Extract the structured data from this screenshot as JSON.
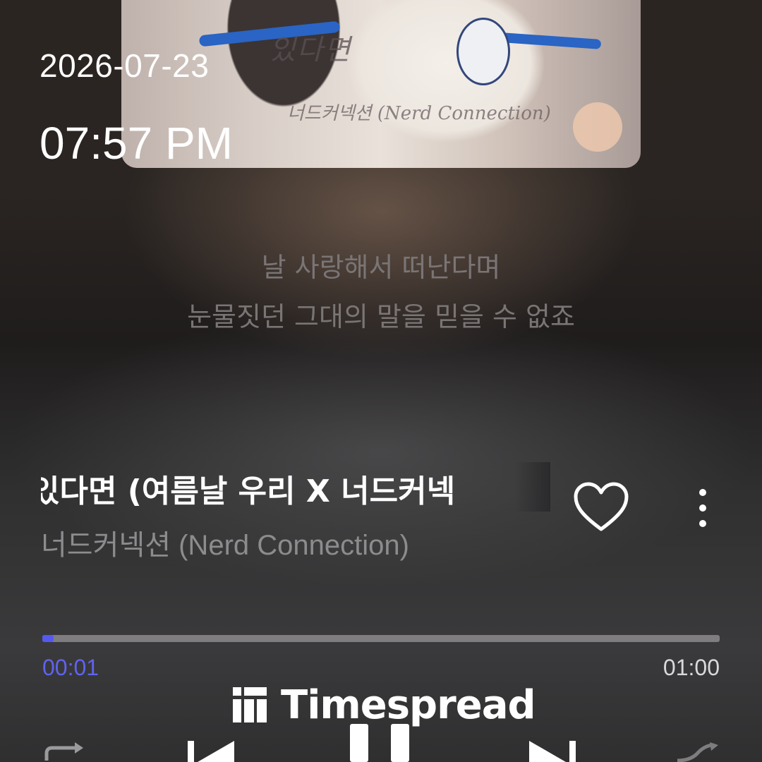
{
  "overlay": {
    "date": "2026-07-23",
    "time": "07:57 PM"
  },
  "album_art": {
    "title_text": "있다면",
    "artist_text": "너드커넥션 (Nerd Connection)"
  },
  "lyrics": {
    "line1": "날 사랑해서 떠난다며",
    "line2": "눈물짓던 그대의 말을 믿을 수 없죠"
  },
  "track": {
    "title": "있다면 (여름날 우리 X 너드커넥",
    "artist": "너드커넥션 (Nerd Connection)",
    "liked": false
  },
  "playback": {
    "elapsed": "00:01",
    "total": "01:00",
    "progress_fraction": 0.017,
    "state": "playing"
  },
  "watermark": {
    "text": "Timespread"
  },
  "colors": {
    "accent": "#5559f0",
    "track": "#7f7d80"
  },
  "icons": {
    "heart": "heart-outline-icon",
    "more": "more-vertical-icon",
    "repeat": "repeat-icon",
    "previous": "skip-previous-icon",
    "pause": "pause-icon",
    "next": "skip-next-icon",
    "shuffle": "shuffle-icon"
  }
}
